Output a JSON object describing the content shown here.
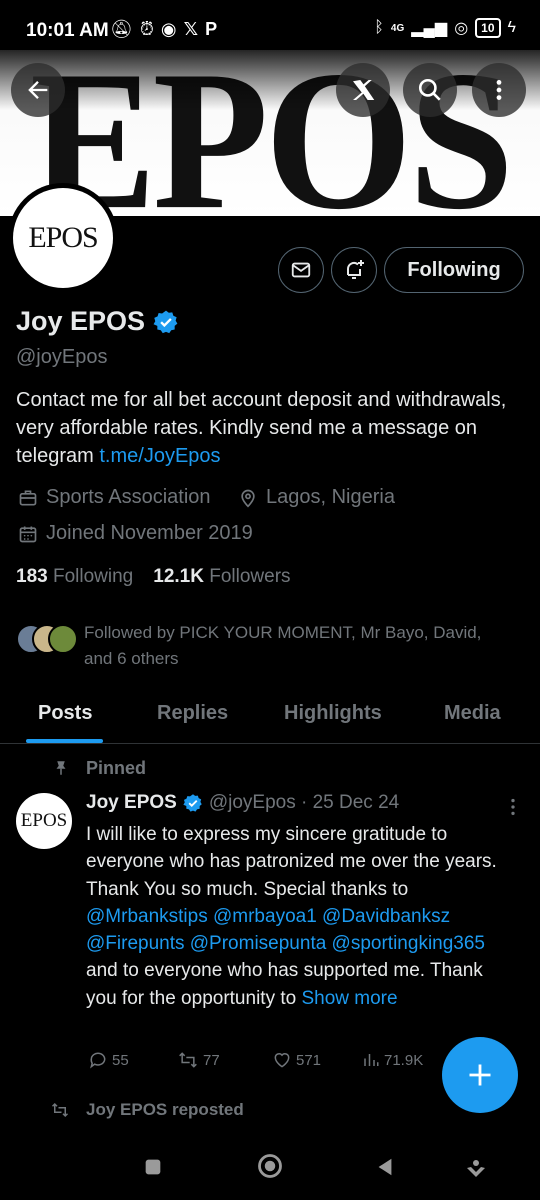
{
  "status_bar": {
    "time": "10:01 AM",
    "left_icons": [
      "mute-bell-icon",
      "alarm-icon",
      "messenger-icon",
      "x-icon",
      "p-icon"
    ],
    "network": "4G",
    "battery": "10"
  },
  "banner": {
    "text": "EPOS"
  },
  "header_buttons": [
    "back-arrow-icon",
    "grok-icon",
    "search-icon",
    "more-vertical-icon"
  ],
  "profile": {
    "avatar_text": "EPOS",
    "name": "Joy EPOS",
    "handle": "@joyEpos",
    "bio_text": "Contact me for all bet account deposit and withdrawals, very affordable rates. Kindly send me a message on telegram ",
    "bio_link": "t.me/JoyEpos",
    "category": "Sports Association",
    "location": "Lagos, Nigeria",
    "joined": "Joined November 2019",
    "following_count": "183",
    "following_label": "Following",
    "followers_count": "12.1K",
    "followers_label": "Followers",
    "followed_by": "Followed by PICK YOUR MOMENT, Mr Bayo, David, and 6 others",
    "follow_button": "Following"
  },
  "tabs": [
    {
      "label": "Posts",
      "active": true
    },
    {
      "label": "Replies",
      "active": false
    },
    {
      "label": "Highlights",
      "active": false
    },
    {
      "label": "Media",
      "active": false
    }
  ],
  "pinned_post": {
    "pinned_label": "Pinned",
    "avatar_text": "EPOS",
    "name": "Joy EPOS",
    "meta": "@joyEpos · 25 Dec 24",
    "text_1": "I will like to express my sincere gratitude to everyone who has patronized me over the years. Thank You so much. Special thanks to ",
    "mentions_1": "@Mrbankstips @mrbayoa1 @Davidbanksz @Firepunts @Promisepunta @sportingking365",
    "text_2": " and to everyone who has supported me. Thank you for the opportunity to ",
    "show_more": "Show more",
    "replies": "55",
    "reposts": "77",
    "likes": "571",
    "views": "71.9K"
  },
  "next_post": {
    "reposted_label": "Joy EPOS reposted"
  },
  "colors": {
    "accent": "#1d9bf0",
    "secondary_text": "#71767b",
    "background": "#000000"
  }
}
